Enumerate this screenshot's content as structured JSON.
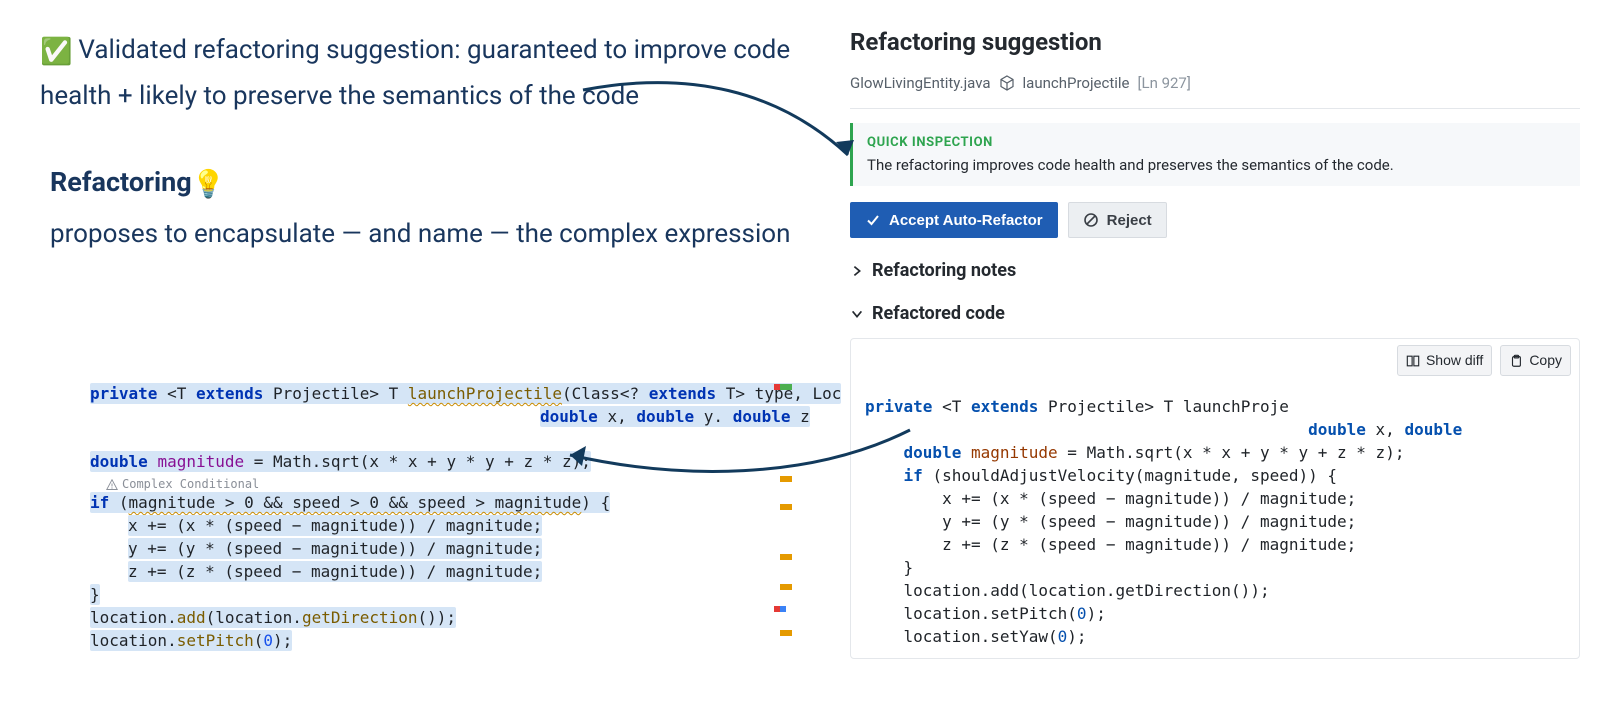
{
  "left": {
    "annot1_prefix_icon": "✅",
    "annot1_text": "Validated refactoring suggestion: guaranteed to improve code health + likely to preserve the semantics of the code",
    "heading": "Refactoring",
    "bulb": "💡",
    "subtext": "proposes to encapsulate — and name  — the complex expression",
    "complex_label": "Complex Conditional"
  },
  "code_left": {
    "l1_a": "private ",
    "l1_b": "<T ",
    "l1_c": "extends ",
    "l1_d": "Projectile> T ",
    "l1_e": "launchProjectile",
    "l1_f": "(Class<? ",
    "l1_g": "extends ",
    "l1_h": "T> type, Loc",
    "l2": "double x, double y. double z",
    "l3_a": "double ",
    "l3_b": "magnitude",
    "l3_c": " = Math.sqrt(",
    "l3_d": "x * x + y * y + z * z",
    "l3_e": ");",
    "l4_a": "if ",
    "l4_b": "(",
    "l4_c": "magnitude > 0 && speed > 0 && speed > magnitude",
    "l4_d": ") {",
    "l5": "x += (x * (speed − magnitude)) / magnitude;",
    "l6": "y += (y * (speed − magnitude)) / magnitude;",
    "l7": "z += (z * (speed − magnitude)) / magnitude;",
    "l8": "}",
    "l9": "location.add(location.getDirection());",
    "l10": "location.setPitch(0);"
  },
  "right": {
    "panel_title": "Refactoring suggestion",
    "crumb_file": "GlowLivingEntity.java",
    "crumb_fn": "launchProjectile",
    "crumb_ln": "[Ln 927]",
    "inspect_title": "QUICK INSPECTION",
    "inspect_body": "The refactoring improves code health and preserves the semantics of the code.",
    "accept": "Accept Auto-Refactor",
    "reject": "Reject",
    "notes": "Refactoring notes",
    "refcode": "Refactored code",
    "show_diff": "Show diff",
    "copy": "Copy"
  },
  "code_right": {
    "l1_a": "private ",
    "l1_b": "<T ",
    "l1_c": "extends ",
    "l1_d": "Projectile> T launchProje",
    "l2": "double x, double ",
    "l3_a": "double ",
    "l3_b": "magnitude",
    "l3_c": " = Math.sqrt(x * x + y * y + z * z);",
    "l4_a": "if ",
    "l4_b": "(shouldAdjustVelocity(magnitude, speed)) {",
    "l5": "x += (x * (speed − magnitude)) / magnitude;",
    "l6": "y += (y * (speed − magnitude)) / magnitude;",
    "l7": "z += (z * (speed − magnitude)) / magnitude;",
    "l8": "}",
    "l9": "location.add(location.getDirection());",
    "l10": "location.setPitch(0);",
    "l11": "location.setYaw(0);"
  }
}
